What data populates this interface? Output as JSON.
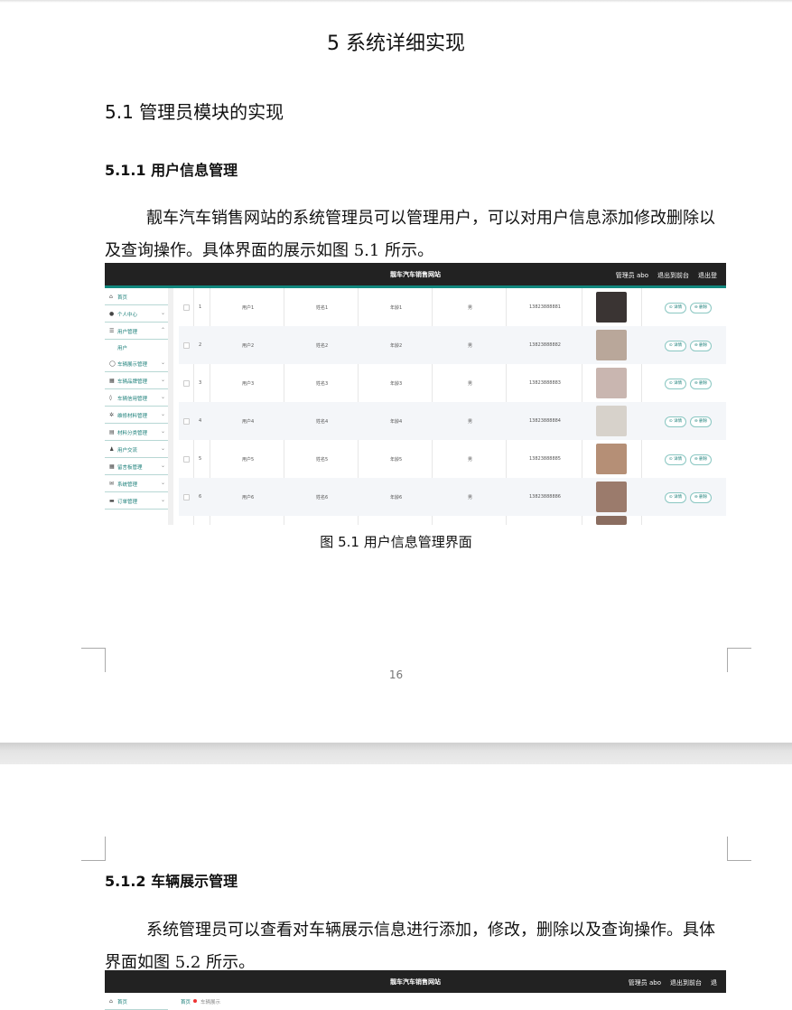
{
  "page1": {
    "chapter_title": "5 系统详细实现",
    "section_title": "5.1  管理员模块的实现",
    "subsection_title": "5.1.1  用户信息管理",
    "paragraph": "靓车汽车销售网站的系统管理员可以管理用户，可以对用户信息添加修改删除以及查询操作。具体界面的展示如图 5.1 所示。",
    "caption": "图 5.1  用户信息管理界面",
    "page_number": "16"
  },
  "screenshot1": {
    "app_title": "靓车汽车销售网站",
    "top_right": [
      "管理员 abo",
      "退出到前台",
      "退出登"
    ],
    "sidebar": [
      {
        "label": "首页",
        "icon": "home-icon",
        "glyph": "⌂",
        "chevron": ""
      },
      {
        "label": "个人中心",
        "icon": "user-icon",
        "glyph": "●",
        "chevron": "⌄"
      },
      {
        "label": "用户管理",
        "icon": "list-icon",
        "glyph": "☰",
        "chevron": "⌃"
      },
      {
        "label": "车辆展示管理",
        "icon": "circle-icon",
        "glyph": "◯",
        "chevron": "⌄"
      },
      {
        "label": "车辆品牌管理",
        "icon": "grid-icon",
        "glyph": "▦",
        "chevron": "⌄"
      },
      {
        "label": "车辆信用管理",
        "icon": "pin-icon",
        "glyph": "◊",
        "chevron": "⌄"
      },
      {
        "label": "维修材料管理",
        "icon": "gear-icon",
        "glyph": "✲",
        "chevron": "⌄"
      },
      {
        "label": "材料分类管理",
        "icon": "table-icon",
        "glyph": "▤",
        "chevron": "⌄"
      },
      {
        "label": "用户交流",
        "icon": "person-icon",
        "glyph": "♟",
        "chevron": "⌄"
      },
      {
        "label": "留言板管理",
        "icon": "apps-icon",
        "glyph": "▦",
        "chevron": "⌄"
      },
      {
        "label": "系统管理",
        "icon": "chat-icon",
        "glyph": "✉",
        "chevron": "⌄"
      },
      {
        "label": "订单管理",
        "icon": "doc-icon",
        "glyph": "▬",
        "chevron": "⌄"
      }
    ],
    "sub_item": "用户",
    "rows": [
      {
        "index": "1",
        "account": "用户1",
        "name": "姓名1",
        "age": "年龄1",
        "gender": "男",
        "phone": "13823888881",
        "photo_color": "#3a3433"
      },
      {
        "index": "2",
        "account": "用户2",
        "name": "姓名2",
        "age": "年龄2",
        "gender": "男",
        "phone": "13823888882",
        "photo_color": "#b9a79a"
      },
      {
        "index": "3",
        "account": "用户3",
        "name": "姓名3",
        "age": "年龄3",
        "gender": "男",
        "phone": "13823888883",
        "photo_color": "#c9b6b0"
      },
      {
        "index": "4",
        "account": "用户4",
        "name": "姓名4",
        "age": "年龄4",
        "gender": "男",
        "phone": "13823888884",
        "photo_color": "#d7d2cb"
      },
      {
        "index": "5",
        "account": "用户5",
        "name": "姓名5",
        "age": "年龄5",
        "gender": "男",
        "phone": "13823888885",
        "photo_color": "#b58f76"
      },
      {
        "index": "6",
        "account": "用户6",
        "name": "姓名6",
        "age": "年龄6",
        "gender": "男",
        "phone": "13823888886",
        "photo_color": "#9b7b6c"
      }
    ],
    "detail_label": "⊙ 详情",
    "delete_label": "⊖ 删除"
  },
  "page2": {
    "subsection_title": "5.1.2  车辆展示管理",
    "paragraph": "系统管理员可以查看对车辆展示信息进行添加，修改，删除以及查询操作。具体界面如图 5.2 所示。"
  },
  "screenshot2": {
    "app_title": "靓车汽车销售网站",
    "top_right": [
      "管理员 abo",
      "退出到前台",
      "退"
    ],
    "sidebar_first": "首页",
    "breadcrumb_home": "首页",
    "breadcrumb_current": "车辆展示"
  },
  "colors": {
    "accent": "#11877e",
    "topbar": "#222222"
  }
}
